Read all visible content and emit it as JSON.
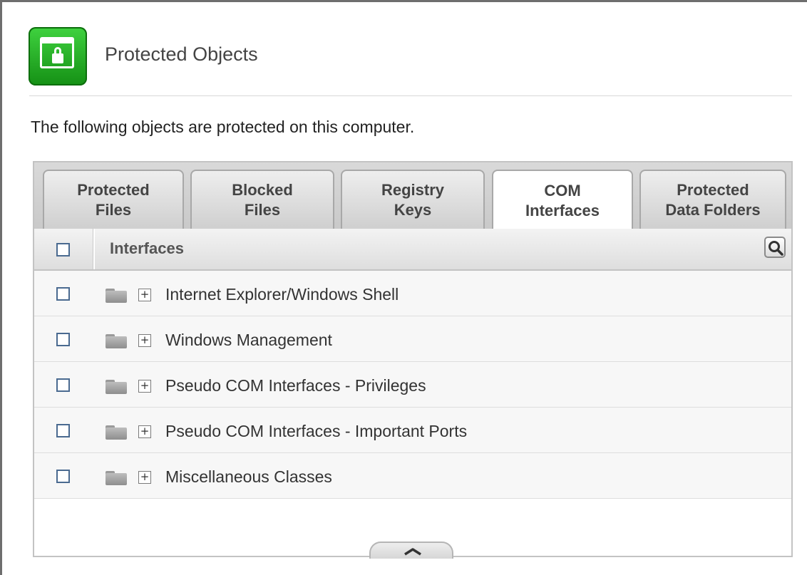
{
  "header": {
    "title": "Protected Objects",
    "icon": "lock-window-icon",
    "icon_color": "#22b022"
  },
  "description": "The following objects are protected on this computer.",
  "tabs": [
    {
      "line1": "Protected",
      "line2": "Files",
      "active": false
    },
    {
      "line1": "Blocked",
      "line2": "Files",
      "active": false
    },
    {
      "line1": "Registry",
      "line2": "Keys",
      "active": false
    },
    {
      "line1": "COM",
      "line2": "Interfaces",
      "active": true
    },
    {
      "line1": "Protected",
      "line2": "Data Folders",
      "active": false
    }
  ],
  "table": {
    "column_header": "Interfaces",
    "search_icon": "search-icon",
    "rows": [
      {
        "label": "Internet Explorer/Windows Shell",
        "expand": "+"
      },
      {
        "label": "Windows Management",
        "expand": "+"
      },
      {
        "label": "Pseudo COM Interfaces - Privileges",
        "expand": "+"
      },
      {
        "label": "Pseudo COM Interfaces - Important Ports",
        "expand": "+"
      },
      {
        "label": "Miscellaneous Classes",
        "expand": "+"
      }
    ]
  },
  "collapse_icon": "chevron-up-icon"
}
